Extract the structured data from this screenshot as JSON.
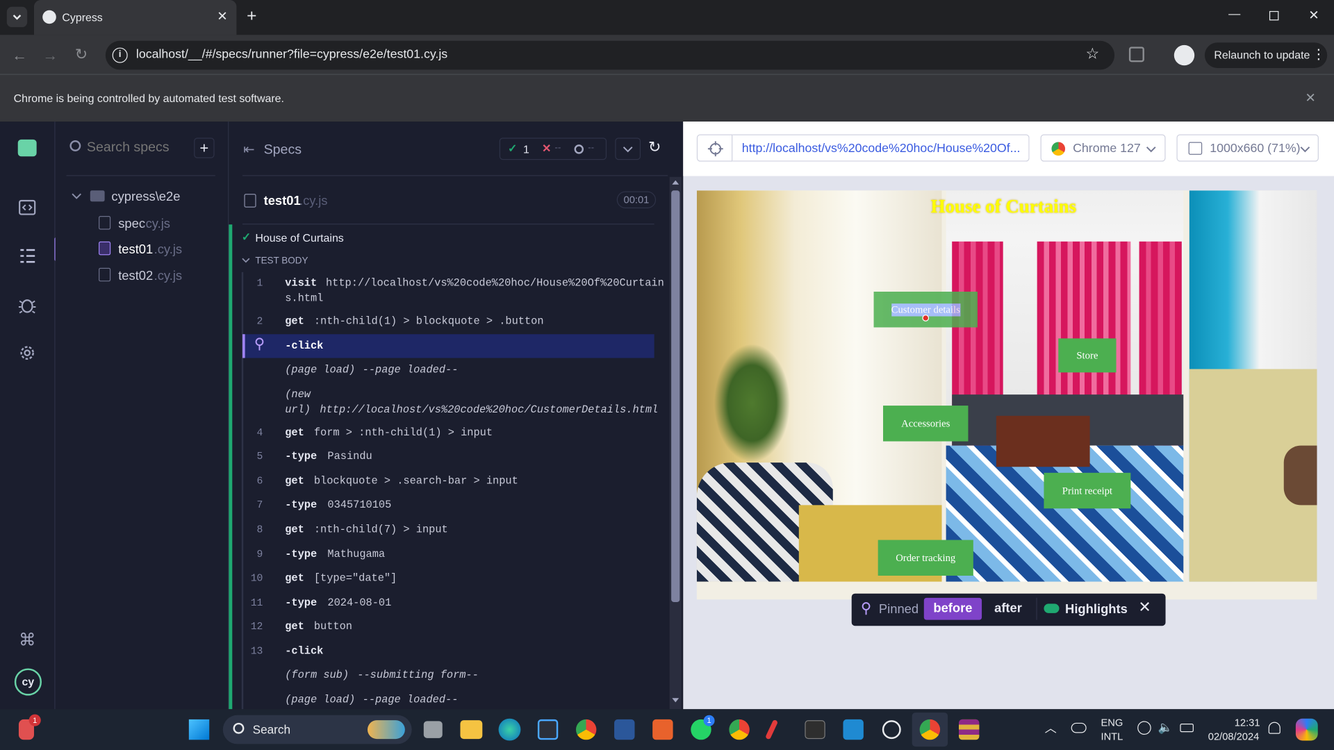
{
  "browser": {
    "tab_title": "Cypress",
    "url": "localhost/__/#/specs/runner?file=cypress/e2e/test01.cy.js",
    "relaunch_label": "Relaunch to update",
    "infobar": "Chrome is being controlled by automated test software."
  },
  "specs_panel": {
    "search_placeholder": "Search specs",
    "folder": "cypress\\e2e",
    "files": [
      {
        "name": "spec",
        "ext": ".cy.js"
      },
      {
        "name": "test01",
        "ext": ".cy.js"
      },
      {
        "name": "test02",
        "ext": ".cy.js"
      }
    ]
  },
  "reporter": {
    "header_label": "Specs",
    "passed": "1",
    "failed": "--",
    "pending": "--",
    "spec_name": "test01",
    "spec_ext": ".cy.js",
    "duration": "00:01",
    "suite": "House of Curtains",
    "test_body": "TEST BODY",
    "commands": [
      {
        "num": "1",
        "name": "visit",
        "msg": "http://localhost/vs%20code%20hoc/House%20Of%20Curtain",
        "msg2": "s.html"
      },
      {
        "num": "2",
        "name": "get",
        "msg": ":nth-child(1) > blockquote > .button"
      },
      {
        "num": "",
        "name": "-click",
        "msg": ""
      },
      {
        "num": "",
        "name": "(page load)",
        "msg": "--page loaded--"
      },
      {
        "num": "",
        "name": "(new",
        "name2": "url)",
        "msg": "http://localhost/vs%20code%20hoc/CustomerDetails.html"
      },
      {
        "num": "4",
        "name": "get",
        "msg": "form > :nth-child(1) > input"
      },
      {
        "num": "5",
        "name": "-type",
        "msg": "Pasindu"
      },
      {
        "num": "6",
        "name": "get",
        "msg": "blockquote > .search-bar > input"
      },
      {
        "num": "7",
        "name": "-type",
        "msg": "0345710105"
      },
      {
        "num": "8",
        "name": "get",
        "msg": ":nth-child(7) > input"
      },
      {
        "num": "9",
        "name": "-type",
        "msg": "Mathugama"
      },
      {
        "num": "10",
        "name": "get",
        "msg": "[type=\"date\"]"
      },
      {
        "num": "11",
        "name": "-type",
        "msg": "2024-08-01"
      },
      {
        "num": "12",
        "name": "get",
        "msg": "button"
      },
      {
        "num": "13",
        "name": "-click",
        "msg": ""
      },
      {
        "num": "",
        "name": "(form sub)",
        "msg": "--submitting form--"
      },
      {
        "num": "",
        "name": "(page load)",
        "msg": "--page loaded--"
      }
    ]
  },
  "aut": {
    "url": "http://localhost/vs%20code%20hoc/House%20Of...",
    "browser": "Chrome 127",
    "viewport": "1000x660 (71%)",
    "page_title": "House of Curtains",
    "buttons": [
      "Customer details",
      "Store",
      "Accessories",
      "Print receipt",
      "Order tracking"
    ],
    "pinned_label": "Pinned",
    "before_label": "before",
    "after_label": "after",
    "highlights_label": "Highlights"
  },
  "taskbar": {
    "search_placeholder": "Search",
    "lang": "ENG",
    "lang2": "INTL",
    "time": "12:31",
    "date": "02/08/2024",
    "notif_badge": "1",
    "whatsapp_badge": "1"
  },
  "colors": {
    "cypress_bg": "#1b1e2e",
    "accent_purple": "#7f43c9",
    "pass_green": "#1fa971",
    "button_green": "#4caf50",
    "link_blue": "#3a5be0"
  }
}
